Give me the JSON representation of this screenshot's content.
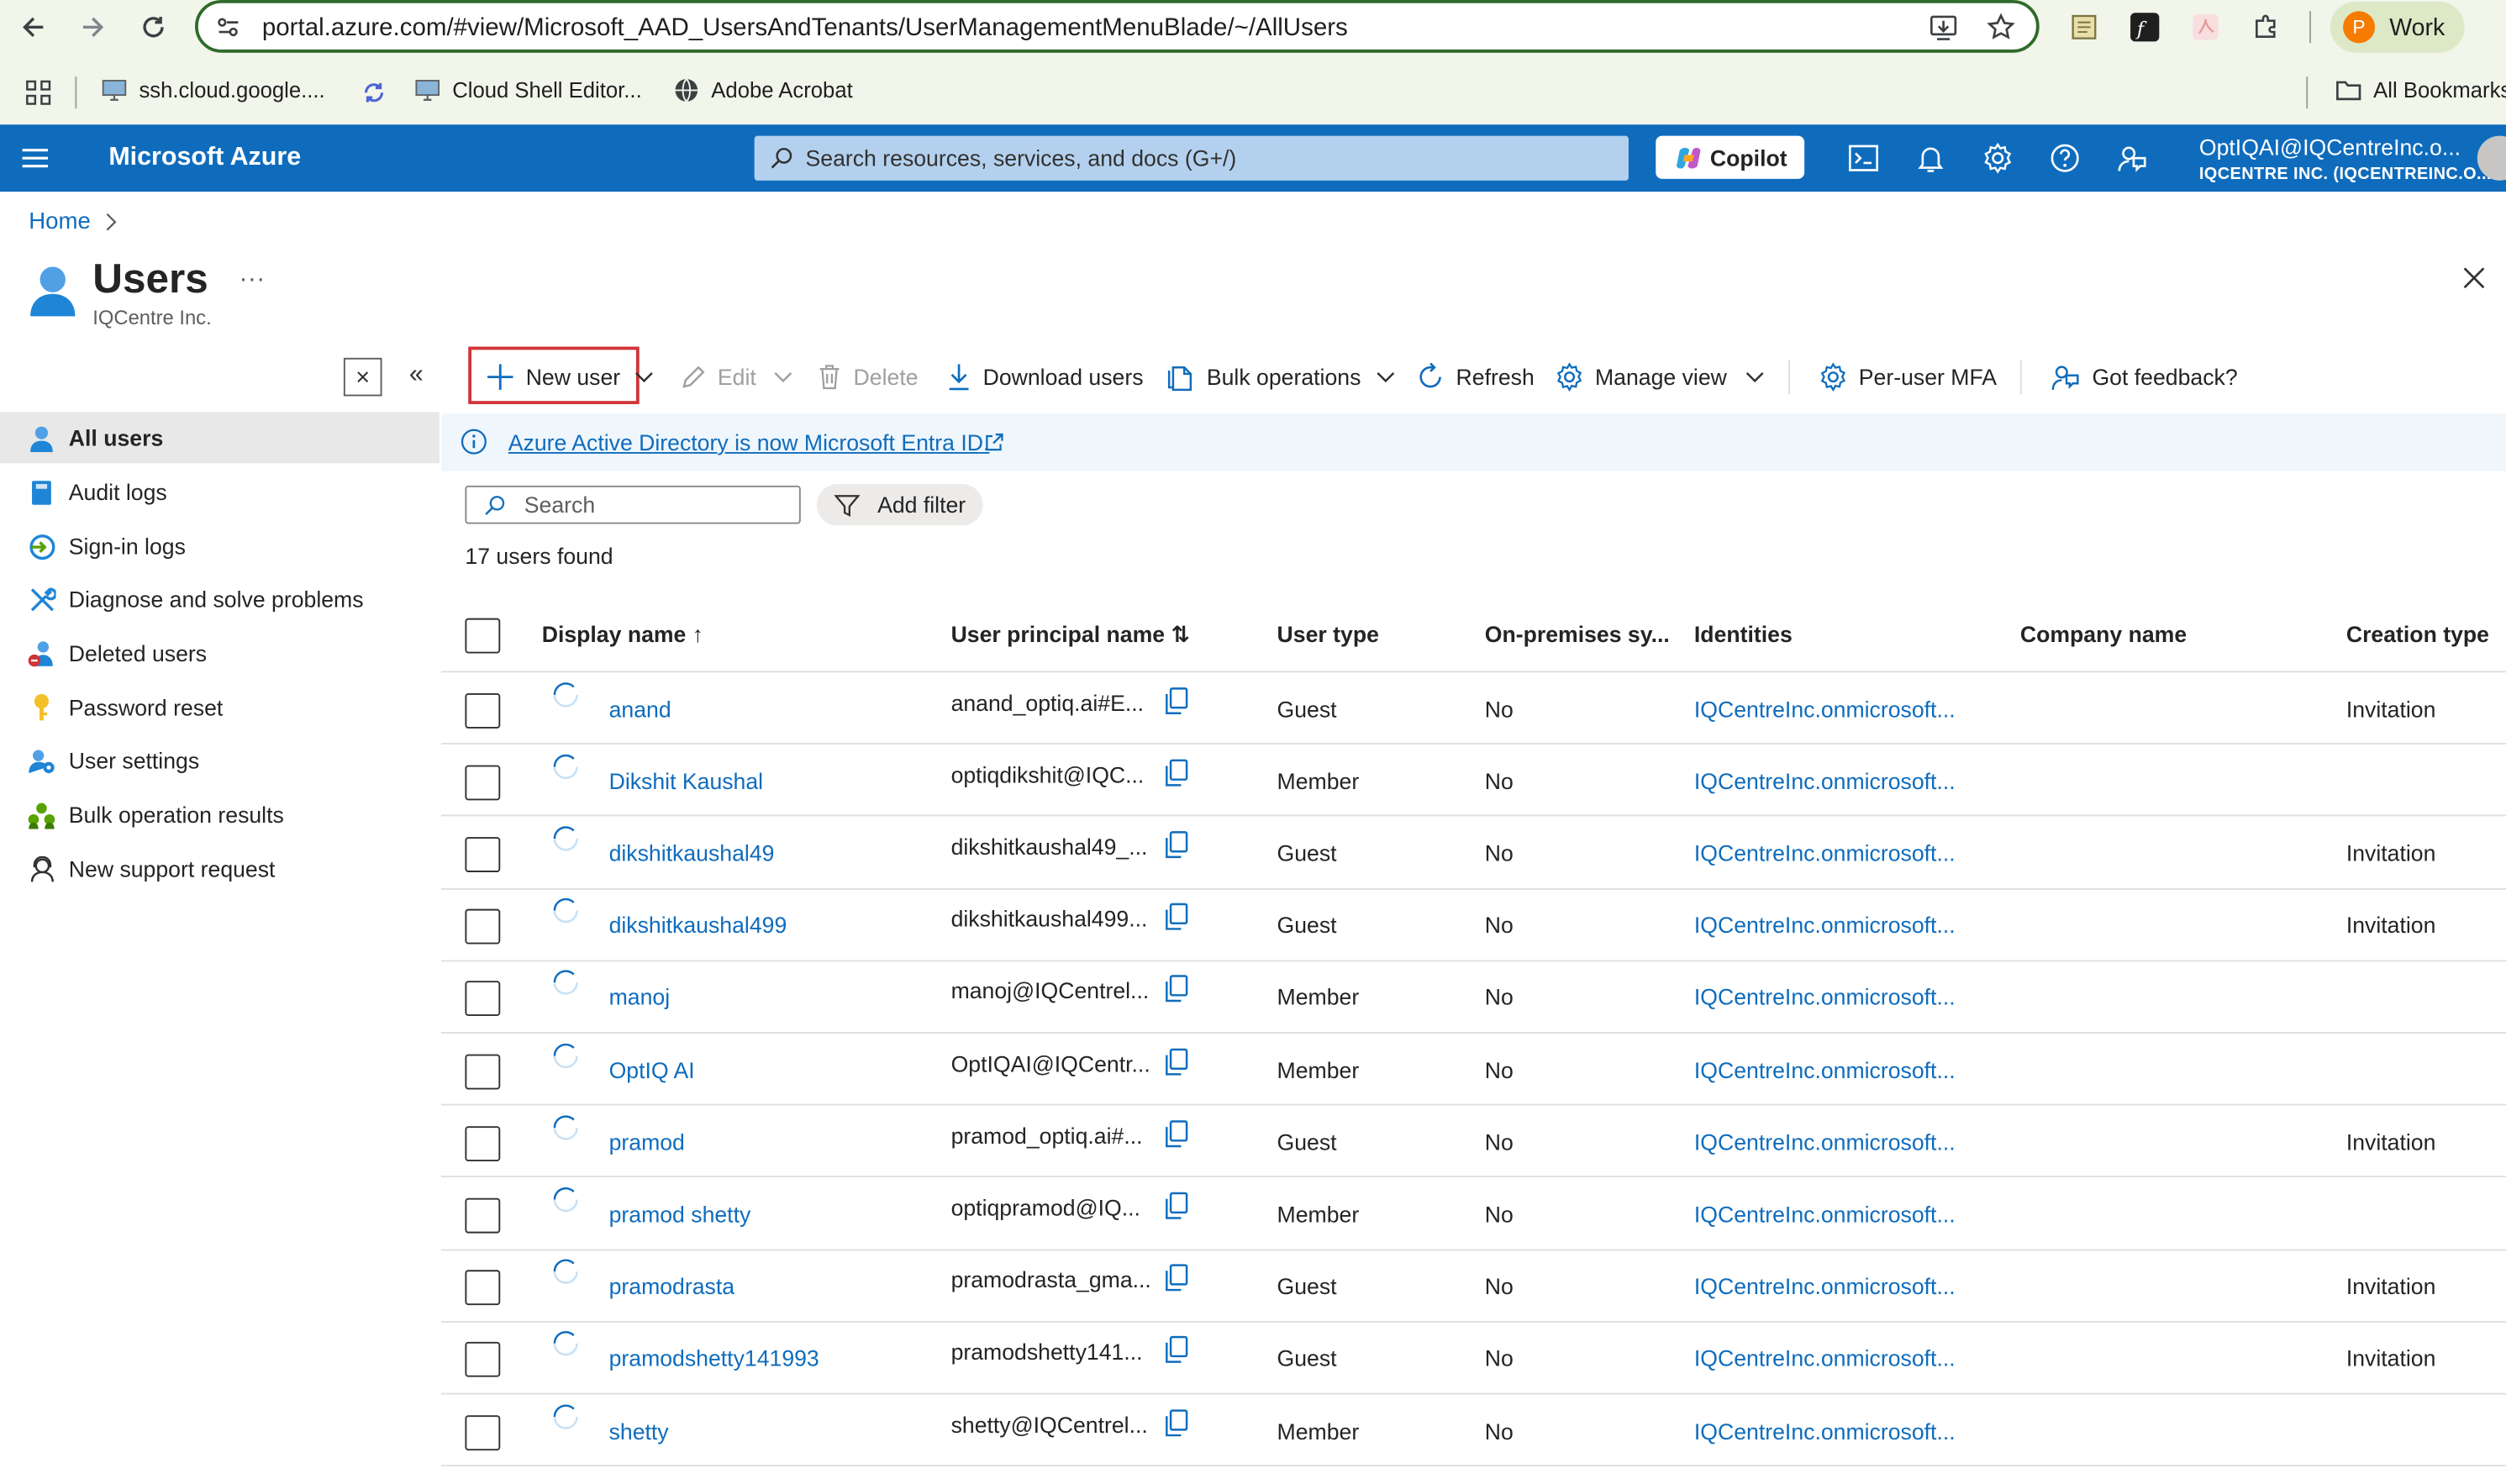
{
  "browser": {
    "url": "portal.azure.com/#view/Microsoft_AAD_UsersAndTenants/UserManagementMenuBlade/~/AllUsers",
    "profile_initial": "P",
    "profile_name": "Work",
    "bookmarks": [
      "ssh.cloud.google....",
      "Cloud Shell Editor...",
      "Adobe Acrobat"
    ],
    "all_bookmarks": "All Bookmarks"
  },
  "header": {
    "brand": "Microsoft Azure",
    "search_placeholder": "Search resources, services, and docs (G+/)",
    "copilot": "Copilot",
    "account_name": "OptIQAI@IQCentreInc.o...",
    "account_org": "IQCENTRE INC. (IQCENTREINC.O..."
  },
  "page": {
    "breadcrumb_home": "Home",
    "title": "Users",
    "subtitle": "IQCentre Inc.",
    "more": "..."
  },
  "sidebar": {
    "items": [
      {
        "label": "All users",
        "icon": "user-icon"
      },
      {
        "label": "Audit logs",
        "icon": "book-icon"
      },
      {
        "label": "Sign-in logs",
        "icon": "sign-in-icon"
      },
      {
        "label": "Diagnose and solve problems",
        "icon": "wrench-icon"
      },
      {
        "label": "Deleted users",
        "icon": "deleted-user-icon"
      },
      {
        "label": "Password reset",
        "icon": "key-icon"
      },
      {
        "label": "User settings",
        "icon": "user-settings-icon"
      },
      {
        "label": "Bulk operation results",
        "icon": "bulk-icon"
      },
      {
        "label": "New support request",
        "icon": "support-icon"
      }
    ]
  },
  "toolbar": {
    "new_user": "New user",
    "edit": "Edit",
    "delete": "Delete",
    "download": "Download users",
    "bulk": "Bulk operations",
    "refresh": "Refresh",
    "manage_view": "Manage view",
    "mfa": "Per-user MFA",
    "feedback": "Got feedback?"
  },
  "info": {
    "text": "Azure Active Directory is now Microsoft Entra ID."
  },
  "filters": {
    "search_placeholder": "Search",
    "add_filter": "Add filter",
    "count": "17 users found"
  },
  "table": {
    "columns": {
      "display_name": "Display name ↑",
      "upn": "User principal name ⇅",
      "user_type": "User type",
      "onprem": "On-premises sy...",
      "identities": "Identities",
      "company": "Company name",
      "creation": "Creation type"
    },
    "rows": [
      {
        "name": "anand",
        "upn": "anand_optiq.ai#E...",
        "type": "Guest",
        "onprem": "No",
        "identities": "IQCentreInc.onmicrosoft...",
        "company": "",
        "creation": "Invitation"
      },
      {
        "name": "Dikshit Kaushal",
        "upn": "optiqdikshit@IQC...",
        "type": "Member",
        "onprem": "No",
        "identities": "IQCentreInc.onmicrosoft...",
        "company": "",
        "creation": ""
      },
      {
        "name": "dikshitkaushal49",
        "upn": "dikshitkaushal49_...",
        "type": "Guest",
        "onprem": "No",
        "identities": "IQCentreInc.onmicrosoft...",
        "company": "",
        "creation": "Invitation"
      },
      {
        "name": "dikshitkaushal499",
        "upn": "dikshitkaushal499...",
        "type": "Guest",
        "onprem": "No",
        "identities": "IQCentreInc.onmicrosoft...",
        "company": "",
        "creation": "Invitation"
      },
      {
        "name": "manoj",
        "upn": "manoj@IQCentrel...",
        "type": "Member",
        "onprem": "No",
        "identities": "IQCentreInc.onmicrosoft...",
        "company": "",
        "creation": ""
      },
      {
        "name": "OptIQ AI",
        "upn": "OptIQAI@IQCentr...",
        "type": "Member",
        "onprem": "No",
        "identities": "IQCentreInc.onmicrosoft...",
        "company": "",
        "creation": ""
      },
      {
        "name": "pramod",
        "upn": "pramod_optiq.ai#...",
        "type": "Guest",
        "onprem": "No",
        "identities": "IQCentreInc.onmicrosoft...",
        "company": "",
        "creation": "Invitation"
      },
      {
        "name": "pramod shetty",
        "upn": "optiqpramod@IQ...",
        "type": "Member",
        "onprem": "No",
        "identities": "IQCentreInc.onmicrosoft...",
        "company": "",
        "creation": ""
      },
      {
        "name": "pramodrasta",
        "upn": "pramodrasta_gma...",
        "type": "Guest",
        "onprem": "No",
        "identities": "IQCentreInc.onmicrosoft...",
        "company": "",
        "creation": "Invitation"
      },
      {
        "name": "pramodshetty141993",
        "upn": "pramodshetty141...",
        "type": "Guest",
        "onprem": "No",
        "identities": "IQCentreInc.onmicrosoft...",
        "company": "",
        "creation": "Invitation"
      },
      {
        "name": "shetty",
        "upn": "shetty@IQCentrel...",
        "type": "Member",
        "onprem": "No",
        "identities": "IQCentreInc.onmicrosoft...",
        "company": "",
        "creation": ""
      }
    ]
  },
  "colors": {
    "azure_blue": "#0f6cbd",
    "highlight_red": "#d13438",
    "chrome_green": "#2f6b2a"
  }
}
